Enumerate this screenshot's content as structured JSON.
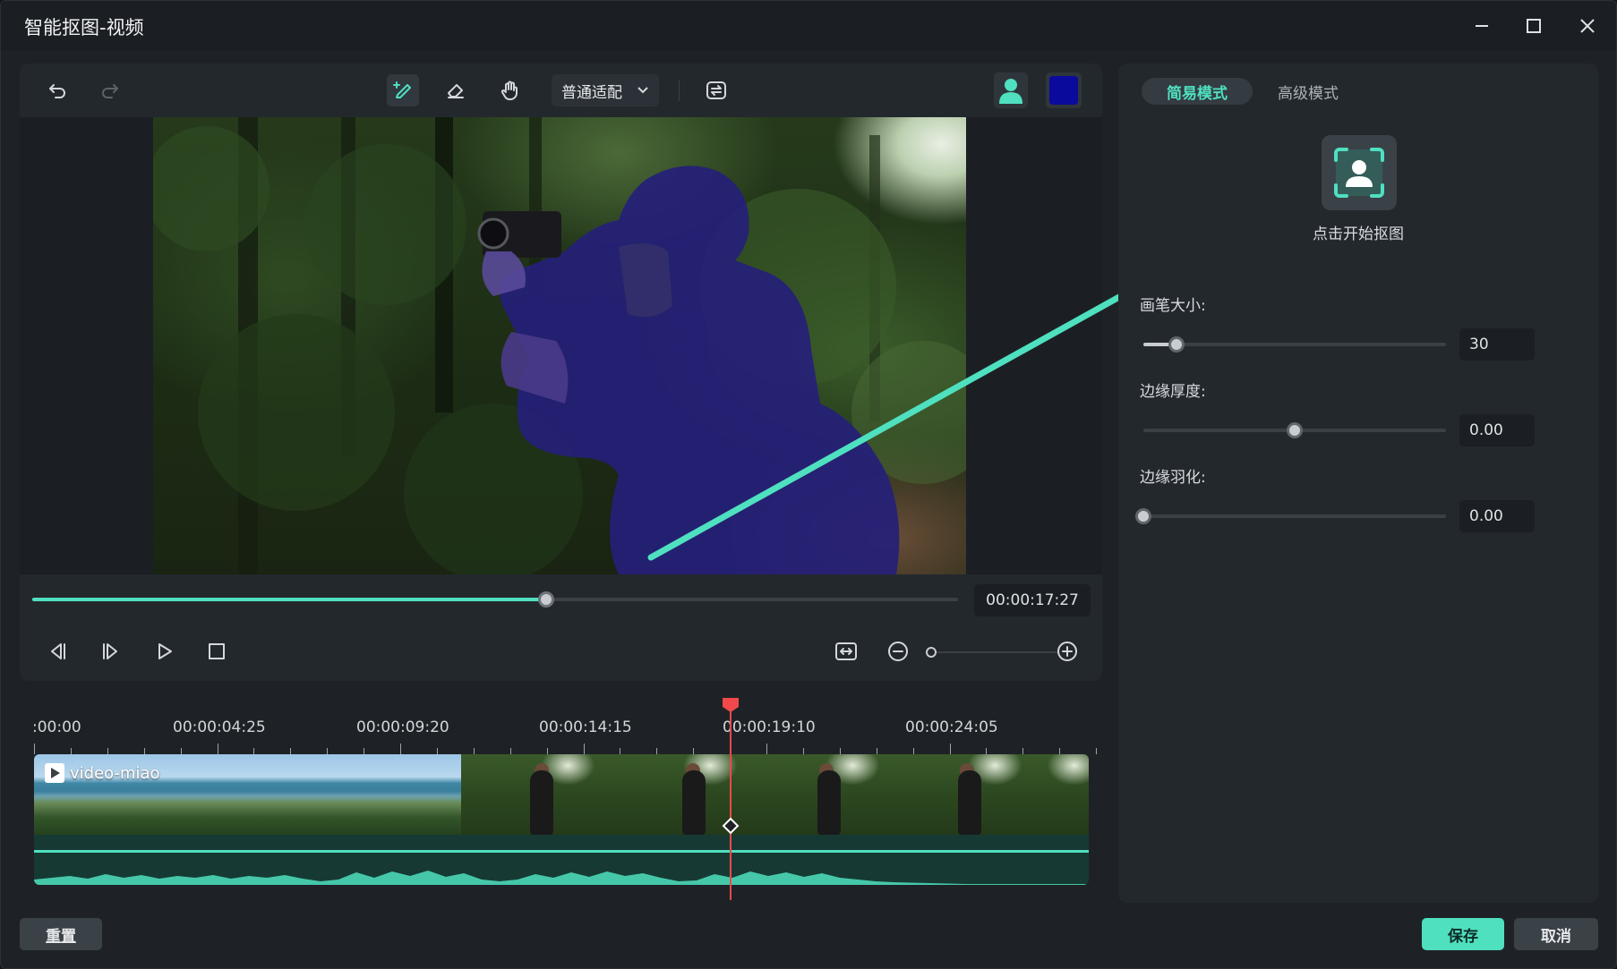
{
  "window": {
    "title": "智能抠图-视频"
  },
  "toolbar": {
    "fit_mode": "普通适配",
    "mask_color": "#0a0a9c"
  },
  "player": {
    "timecode": "00:00:17:27",
    "progress": 0.555,
    "zoom_level": 0.0
  },
  "timeline": {
    "ruler_labels": [
      ":00:00",
      "00:00:04:25",
      "00:00:09:20",
      "00:00:14:15",
      "00:00:19:10",
      "00:00:24:05"
    ],
    "clip_name": "video-miao"
  },
  "right_panel": {
    "tabs": [
      {
        "label": "简易模式",
        "active": true
      },
      {
        "label": "高级模式",
        "active": false
      }
    ],
    "start_label": "点击开始抠图",
    "brush_size": {
      "label": "画笔大小:",
      "value": "30",
      "level": 0.11
    },
    "edge_thickness": {
      "label": "边缘厚度:",
      "value": "0.00",
      "level": 0.5
    },
    "edge_feather": {
      "label": "边缘羽化:",
      "value": "0.00",
      "level": 0.0
    }
  },
  "footer": {
    "reset_label": "重置",
    "save_label": "保存",
    "cancel_label": "取消"
  },
  "colors": {
    "accent": "#4fe0c0",
    "playhead": "#f0484b",
    "mask": "#0a0a9c"
  }
}
